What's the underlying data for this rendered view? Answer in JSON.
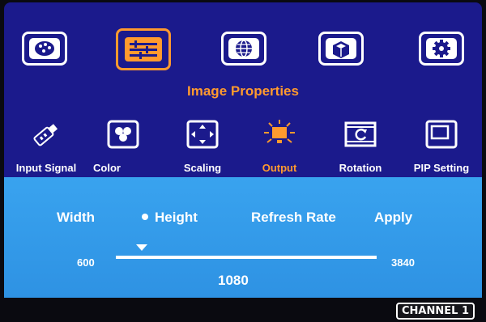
{
  "menu": {
    "title": "Image Properties",
    "top_icons": [
      {
        "name": "palette-icon",
        "active": false
      },
      {
        "name": "image-properties-icon",
        "active": true
      },
      {
        "name": "globe-icon",
        "active": false
      },
      {
        "name": "3d-cube-icon",
        "active": false
      },
      {
        "name": "gear-icon",
        "active": false
      }
    ],
    "items": [
      {
        "label": "Input Signal",
        "icon": "usb-plug-icon",
        "active": false
      },
      {
        "label": "Color",
        "icon": "color-circles-icon",
        "active": false
      },
      {
        "label": "Scaling",
        "icon": "scaling-arrows-icon",
        "active": false
      },
      {
        "label": "Output",
        "icon": "monitor-output-icon",
        "active": true
      },
      {
        "label": "Rotation",
        "icon": "rotation-icon",
        "active": false
      },
      {
        "label": "PIP Setting",
        "icon": "pip-window-icon",
        "active": false
      }
    ]
  },
  "panel": {
    "options": [
      "Width",
      "Height",
      "Refresh Rate",
      "Apply"
    ],
    "selected": "Height",
    "slider": {
      "min": "600",
      "max": "3840",
      "value": "1080",
      "fraction": 0.1
    }
  },
  "badge": "CHANNEL 1",
  "colors": {
    "osd_bg": "#1b1a8c",
    "accent": "#ff9a2e",
    "panel_bg": "#39a3ef"
  }
}
